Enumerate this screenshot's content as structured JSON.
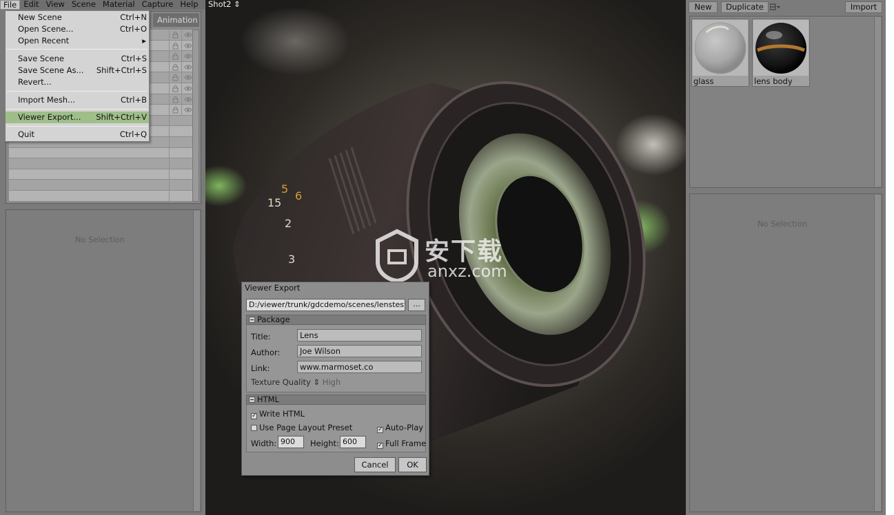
{
  "menubar": {
    "items": [
      "File",
      "Edit",
      "View",
      "Scene",
      "Material",
      "Capture",
      "Help"
    ]
  },
  "scene_panel": {
    "tab_label": "Animation"
  },
  "file_menu": {
    "items": [
      {
        "label": "New Scene",
        "shortcut": "Ctrl+N"
      },
      {
        "label": "Open Scene...",
        "shortcut": "Ctrl+O"
      },
      {
        "label": "Open Recent",
        "shortcut": "▸"
      },
      {
        "label": "Save Scene",
        "shortcut": "Ctrl+S"
      },
      {
        "label": "Save Scene As...",
        "shortcut": "Shift+Ctrl+S"
      },
      {
        "label": "Revert...",
        "shortcut": ""
      },
      {
        "label": "Import Mesh...",
        "shortcut": "Ctrl+B"
      },
      {
        "label": "Viewer Export...",
        "shortcut": "Shift+Ctrl+V"
      },
      {
        "label": "Quit",
        "shortcut": "Ctrl+Q"
      }
    ],
    "highlighted": "Viewer Export..."
  },
  "left_props": {
    "empty_text": "No Selection"
  },
  "viewport": {
    "shot_label": "Shot2 ⇕"
  },
  "watermark": {
    "title": "安下载",
    "url": "anxz.com"
  },
  "viewer_export": {
    "title": "Viewer Export",
    "path": "D:/viewer/trunk/gdcdemo/scenes/lenstester",
    "browse_label": "...",
    "package": {
      "header": "Package",
      "title_label": "Title:",
      "title_value": "Lens",
      "author_label": "Author:",
      "author_value": "Joe Wilson",
      "link_label": "Link:",
      "link_value": "www.marmoset.co",
      "texture_quality_label": "Texture Quality ⇕",
      "texture_quality_value": "High"
    },
    "html": {
      "header": "HTML",
      "write_html_label": "Write HTML",
      "write_html_checked": true,
      "use_page_layout_label": "Use Page Layout Preset",
      "use_page_layout_checked": false,
      "auto_play_label": "Auto-Play",
      "auto_play_checked": true,
      "width_label": "Width:",
      "width_value": "900",
      "height_label": "Height:",
      "height_value": "600",
      "full_frame_label": "Full Frame",
      "full_frame_checked": true
    },
    "cancel_label": "Cancel",
    "ok_label": "OK"
  },
  "materials": {
    "toolbar": {
      "new_label": "New",
      "duplicate_label": "Duplicate",
      "import_label": "Import"
    },
    "items": [
      {
        "name": "glass"
      },
      {
        "name": "lens body"
      }
    ]
  },
  "right_props": {
    "empty_text": "No Selection"
  },
  "colors": {
    "menu_highlight": "#9fbf8a",
    "panel_gray": "#7b7b7b"
  }
}
